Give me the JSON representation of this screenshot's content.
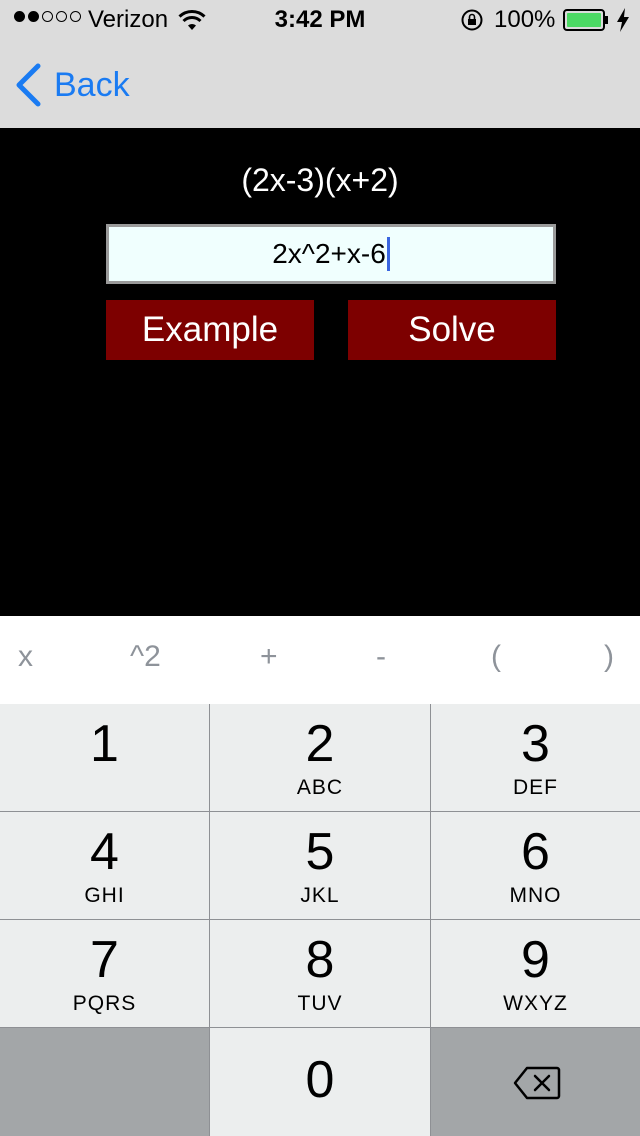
{
  "status_bar": {
    "carrier": "Verizon",
    "time": "3:42 PM",
    "battery": "100%",
    "signal_dots_filled": 2,
    "signal_dots_total": 5
  },
  "nav": {
    "back_label": "Back"
  },
  "main": {
    "factored_result": "(2x-3)(x+2)",
    "input_value": "2x^2+x-6",
    "example_label": "Example",
    "solve_label": "Solve"
  },
  "accessory_keys": [
    "x",
    "^2",
    "+",
    "-",
    "(",
    ")"
  ],
  "keypad": [
    {
      "num": "1",
      "letters": ""
    },
    {
      "num": "2",
      "letters": "ABC"
    },
    {
      "num": "3",
      "letters": "DEF"
    },
    {
      "num": "4",
      "letters": "GHI"
    },
    {
      "num": "5",
      "letters": "JKL"
    },
    {
      "num": "6",
      "letters": "MNO"
    },
    {
      "num": "7",
      "letters": "PQRS"
    },
    {
      "num": "8",
      "letters": "TUV"
    },
    {
      "num": "9",
      "letters": "WXYZ"
    },
    {
      "num": "0",
      "letters": ""
    }
  ],
  "colors": {
    "accent": "#1a7bf2",
    "button_bg": "#7d0000",
    "battery_green": "#4cd964",
    "input_bg": "#f0fffe"
  }
}
